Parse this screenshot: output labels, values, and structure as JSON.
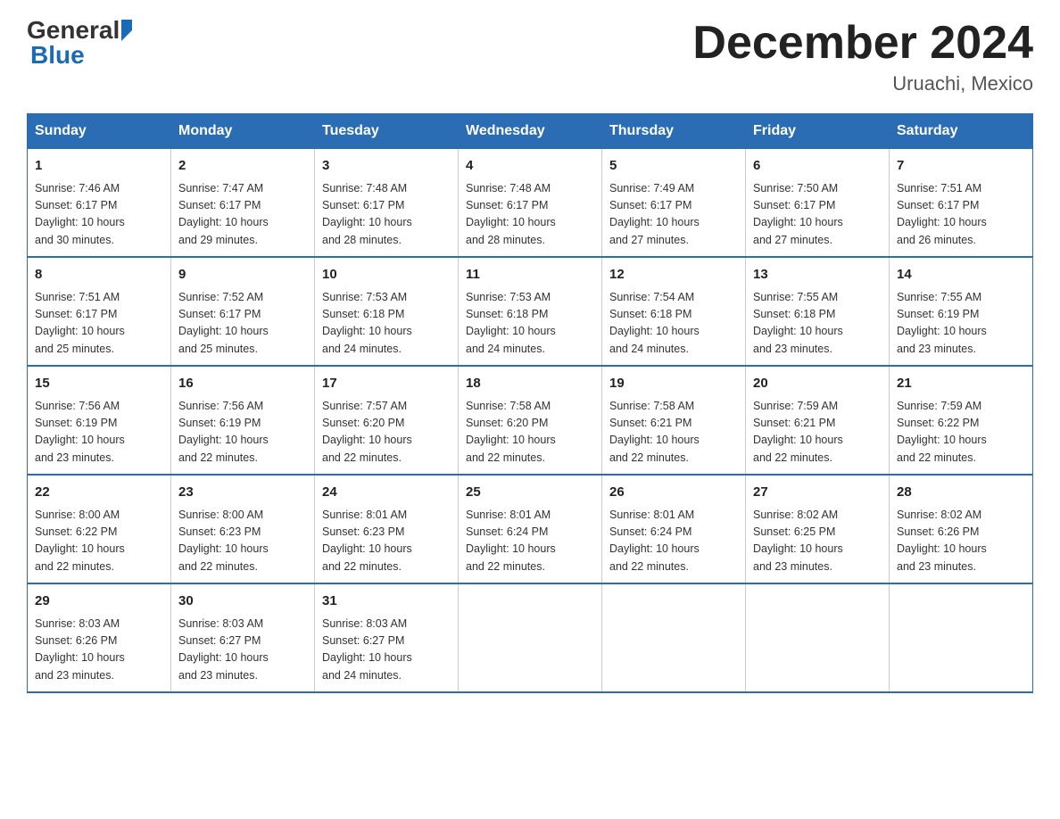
{
  "header": {
    "logo_general": "General",
    "logo_blue": "Blue",
    "month_title": "December 2024",
    "location": "Uruachi, Mexico"
  },
  "weekdays": [
    "Sunday",
    "Monday",
    "Tuesday",
    "Wednesday",
    "Thursday",
    "Friday",
    "Saturday"
  ],
  "weeks": [
    [
      {
        "day": "1",
        "info": "Sunrise: 7:46 AM\nSunset: 6:17 PM\nDaylight: 10 hours\nand 30 minutes."
      },
      {
        "day": "2",
        "info": "Sunrise: 7:47 AM\nSunset: 6:17 PM\nDaylight: 10 hours\nand 29 minutes."
      },
      {
        "day": "3",
        "info": "Sunrise: 7:48 AM\nSunset: 6:17 PM\nDaylight: 10 hours\nand 28 minutes."
      },
      {
        "day": "4",
        "info": "Sunrise: 7:48 AM\nSunset: 6:17 PM\nDaylight: 10 hours\nand 28 minutes."
      },
      {
        "day": "5",
        "info": "Sunrise: 7:49 AM\nSunset: 6:17 PM\nDaylight: 10 hours\nand 27 minutes."
      },
      {
        "day": "6",
        "info": "Sunrise: 7:50 AM\nSunset: 6:17 PM\nDaylight: 10 hours\nand 27 minutes."
      },
      {
        "day": "7",
        "info": "Sunrise: 7:51 AM\nSunset: 6:17 PM\nDaylight: 10 hours\nand 26 minutes."
      }
    ],
    [
      {
        "day": "8",
        "info": "Sunrise: 7:51 AM\nSunset: 6:17 PM\nDaylight: 10 hours\nand 25 minutes."
      },
      {
        "day": "9",
        "info": "Sunrise: 7:52 AM\nSunset: 6:17 PM\nDaylight: 10 hours\nand 25 minutes."
      },
      {
        "day": "10",
        "info": "Sunrise: 7:53 AM\nSunset: 6:18 PM\nDaylight: 10 hours\nand 24 minutes."
      },
      {
        "day": "11",
        "info": "Sunrise: 7:53 AM\nSunset: 6:18 PM\nDaylight: 10 hours\nand 24 minutes."
      },
      {
        "day": "12",
        "info": "Sunrise: 7:54 AM\nSunset: 6:18 PM\nDaylight: 10 hours\nand 24 minutes."
      },
      {
        "day": "13",
        "info": "Sunrise: 7:55 AM\nSunset: 6:18 PM\nDaylight: 10 hours\nand 23 minutes."
      },
      {
        "day": "14",
        "info": "Sunrise: 7:55 AM\nSunset: 6:19 PM\nDaylight: 10 hours\nand 23 minutes."
      }
    ],
    [
      {
        "day": "15",
        "info": "Sunrise: 7:56 AM\nSunset: 6:19 PM\nDaylight: 10 hours\nand 23 minutes."
      },
      {
        "day": "16",
        "info": "Sunrise: 7:56 AM\nSunset: 6:19 PM\nDaylight: 10 hours\nand 22 minutes."
      },
      {
        "day": "17",
        "info": "Sunrise: 7:57 AM\nSunset: 6:20 PM\nDaylight: 10 hours\nand 22 minutes."
      },
      {
        "day": "18",
        "info": "Sunrise: 7:58 AM\nSunset: 6:20 PM\nDaylight: 10 hours\nand 22 minutes."
      },
      {
        "day": "19",
        "info": "Sunrise: 7:58 AM\nSunset: 6:21 PM\nDaylight: 10 hours\nand 22 minutes."
      },
      {
        "day": "20",
        "info": "Sunrise: 7:59 AM\nSunset: 6:21 PM\nDaylight: 10 hours\nand 22 minutes."
      },
      {
        "day": "21",
        "info": "Sunrise: 7:59 AM\nSunset: 6:22 PM\nDaylight: 10 hours\nand 22 minutes."
      }
    ],
    [
      {
        "day": "22",
        "info": "Sunrise: 8:00 AM\nSunset: 6:22 PM\nDaylight: 10 hours\nand 22 minutes."
      },
      {
        "day": "23",
        "info": "Sunrise: 8:00 AM\nSunset: 6:23 PM\nDaylight: 10 hours\nand 22 minutes."
      },
      {
        "day": "24",
        "info": "Sunrise: 8:01 AM\nSunset: 6:23 PM\nDaylight: 10 hours\nand 22 minutes."
      },
      {
        "day": "25",
        "info": "Sunrise: 8:01 AM\nSunset: 6:24 PM\nDaylight: 10 hours\nand 22 minutes."
      },
      {
        "day": "26",
        "info": "Sunrise: 8:01 AM\nSunset: 6:24 PM\nDaylight: 10 hours\nand 22 minutes."
      },
      {
        "day": "27",
        "info": "Sunrise: 8:02 AM\nSunset: 6:25 PM\nDaylight: 10 hours\nand 23 minutes."
      },
      {
        "day": "28",
        "info": "Sunrise: 8:02 AM\nSunset: 6:26 PM\nDaylight: 10 hours\nand 23 minutes."
      }
    ],
    [
      {
        "day": "29",
        "info": "Sunrise: 8:03 AM\nSunset: 6:26 PM\nDaylight: 10 hours\nand 23 minutes."
      },
      {
        "day": "30",
        "info": "Sunrise: 8:03 AM\nSunset: 6:27 PM\nDaylight: 10 hours\nand 23 minutes."
      },
      {
        "day": "31",
        "info": "Sunrise: 8:03 AM\nSunset: 6:27 PM\nDaylight: 10 hours\nand 24 minutes."
      },
      {
        "day": "",
        "info": ""
      },
      {
        "day": "",
        "info": ""
      },
      {
        "day": "",
        "info": ""
      },
      {
        "day": "",
        "info": ""
      }
    ]
  ]
}
